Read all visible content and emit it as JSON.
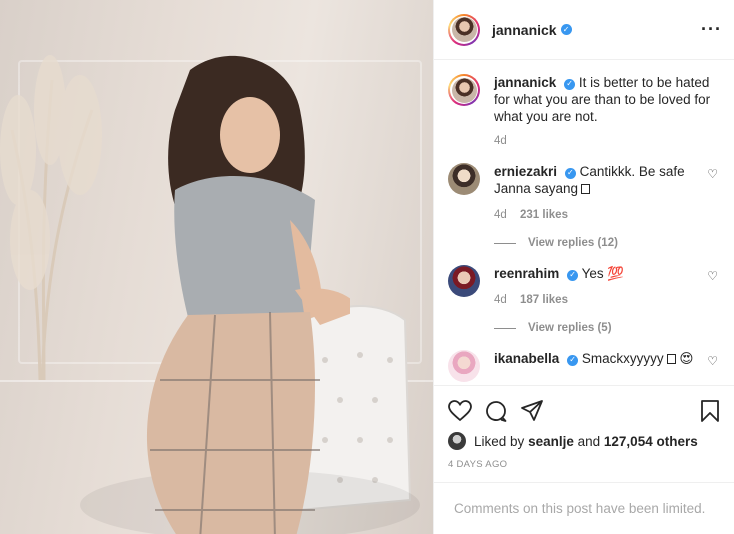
{
  "post": {
    "username": "jannanick",
    "caption": "It is better to be hated for what you are than to be loved for what you are not.",
    "caption_time": "4d"
  },
  "comments": [
    {
      "username": "erniezakri",
      "text": "Cantikkk. Be safe Janna sayang",
      "time": "4d",
      "likes": "231 likes",
      "view_replies": "View replies (12)"
    },
    {
      "username": "reenrahim",
      "text": "Yes",
      "emoji": "💯",
      "time": "4d",
      "likes": "187 likes",
      "view_replies": "View replies (5)"
    },
    {
      "username": "ikanabella",
      "text": "Smackxyyyyy",
      "emoji": "😍"
    }
  ],
  "actions": {
    "liked_by_prefix": "Liked by",
    "liked_by_user": "seanlje",
    "liked_by_mid": "and",
    "liked_by_count": "127,054 others",
    "date": "4 DAYS AGO",
    "comments_limited": "Comments on this post have been limited."
  },
  "icons": {
    "more": "more-options-icon",
    "heart": "heart-icon",
    "comment": "comment-icon",
    "share": "share-icon",
    "save": "bookmark-icon",
    "verified": "verified-badge-icon"
  },
  "colors": {
    "verified": "#3897f0",
    "muted": "#8e8e8e",
    "text": "#262626",
    "border": "#efefef"
  }
}
